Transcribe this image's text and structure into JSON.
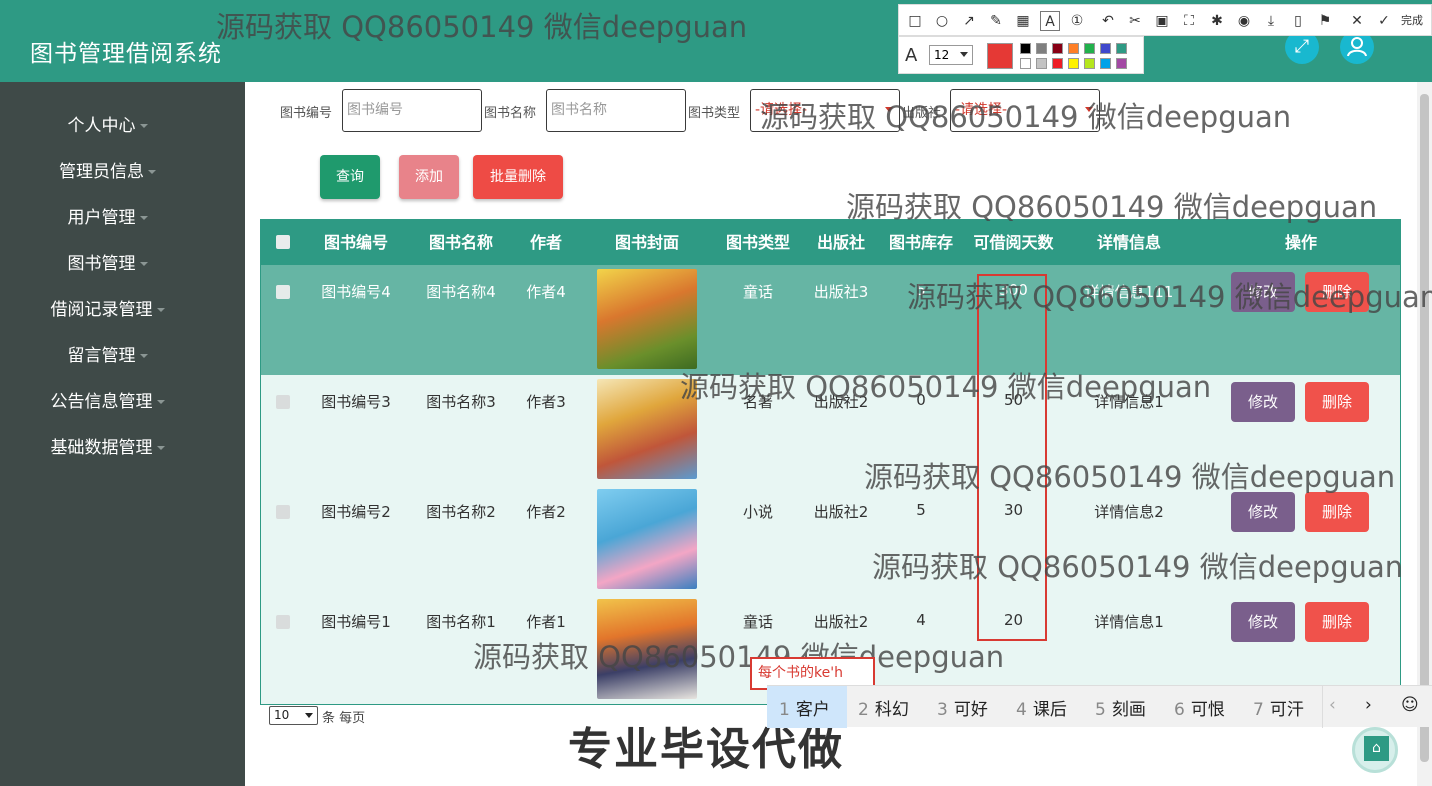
{
  "app": {
    "title": "图书管理借阅系统"
  },
  "header": {
    "icons": [
      "fullscreen-icon",
      "user-icon"
    ]
  },
  "sidebar": {
    "items": [
      {
        "label": "个人中心"
      },
      {
        "label": "管理员信息"
      },
      {
        "label": "用户管理"
      },
      {
        "label": "图书管理"
      },
      {
        "label": "借阅记录管理"
      },
      {
        "label": "留言管理"
      },
      {
        "label": "公告信息管理"
      },
      {
        "label": "基础数据管理"
      }
    ]
  },
  "search": {
    "book_no_label": "图书编号",
    "book_no_placeholder": "图书编号",
    "book_name_label": "图书名称",
    "book_name_placeholder": "图书名称",
    "book_type_label": "图书类型",
    "book_type_value": "-请选择-",
    "publisher_label": "出版社",
    "publisher_value": "-请选择-"
  },
  "actions": {
    "query": "查询",
    "add": "添加",
    "batch_delete": "批量删除"
  },
  "table": {
    "headers": [
      "图书编号",
      "图书名称",
      "作者",
      "图书封面",
      "图书类型",
      "出版社",
      "图书库存",
      "可借阅天数",
      "详情信息",
      "操作"
    ],
    "rows": [
      {
        "no": "图书编号4",
        "name": "图书名称4",
        "author": "作者4",
        "type": "童话",
        "publisher": "出版社3",
        "stock": "5",
        "days": "300",
        "detail": "详情信息111",
        "cover": "#c2572a"
      },
      {
        "no": "图书编号3",
        "name": "图书名称3",
        "author": "作者3",
        "type": "名著",
        "publisher": "出版社2",
        "stock": "0",
        "days": "50",
        "detail": "详情信息1",
        "cover": "#e0a63c"
      },
      {
        "no": "图书编号2",
        "name": "图书名称2",
        "author": "作者2",
        "type": "小说",
        "publisher": "出版社2",
        "stock": "5",
        "days": "30",
        "detail": "详情信息2",
        "cover": "#4aa6d6"
      },
      {
        "no": "图书编号1",
        "name": "图书名称1",
        "author": "作者1",
        "type": "童话",
        "publisher": "出版社2",
        "stock": "4",
        "days": "20",
        "detail": "详情信息1",
        "cover": "#e2752b"
      }
    ],
    "edit_label": "修改",
    "delete_label": "删除"
  },
  "pagination": {
    "page_size": "10",
    "per_page_label": "条 每页"
  },
  "colors": {
    "primary": "#2e9a84",
    "sidebar": "#3f4a48",
    "edit": "#7a5f8c",
    "delete": "#f0524b",
    "highlight": "#d83a32"
  },
  "annotation_toolbar": {
    "font_size": "12",
    "done_label": "完成"
  },
  "ime": {
    "typed": "每个书的ke'h",
    "candidates": [
      {
        "n": "1",
        "text": "客户"
      },
      {
        "n": "2",
        "text": "科幻"
      },
      {
        "n": "3",
        "text": "可好"
      },
      {
        "n": "4",
        "text": "课后"
      },
      {
        "n": "5",
        "text": "刻画"
      },
      {
        "n": "6",
        "text": "可恨"
      },
      {
        "n": "7",
        "text": "可汗"
      }
    ]
  },
  "watermark": {
    "text": "源码获取 QQ86050149 微信deepguan",
    "promo": "专业毕设代做"
  }
}
